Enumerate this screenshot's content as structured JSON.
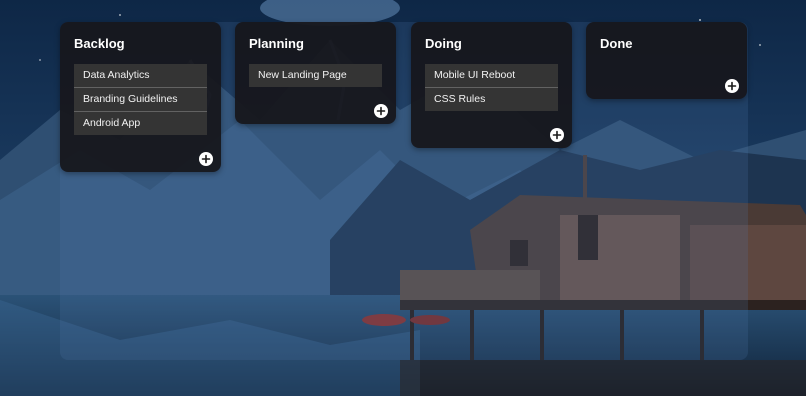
{
  "board": {
    "columns": [
      {
        "title": "Backlog",
        "cards": [
          "Data Analytics",
          "Branding Guidelines",
          "Android App"
        ]
      },
      {
        "title": "Planning",
        "cards": [
          "New Landing Page"
        ]
      },
      {
        "title": "Doing",
        "cards": [
          "Mobile UI Reboot",
          "CSS Rules"
        ]
      },
      {
        "title": "Done",
        "cards": []
      }
    ],
    "add_button_icon": "plus-circle-icon"
  },
  "colors": {
    "column_bg": "#16161c",
    "card_bg": "#343434",
    "card_text": "#f2f2f2",
    "title_text": "#ffffff"
  }
}
